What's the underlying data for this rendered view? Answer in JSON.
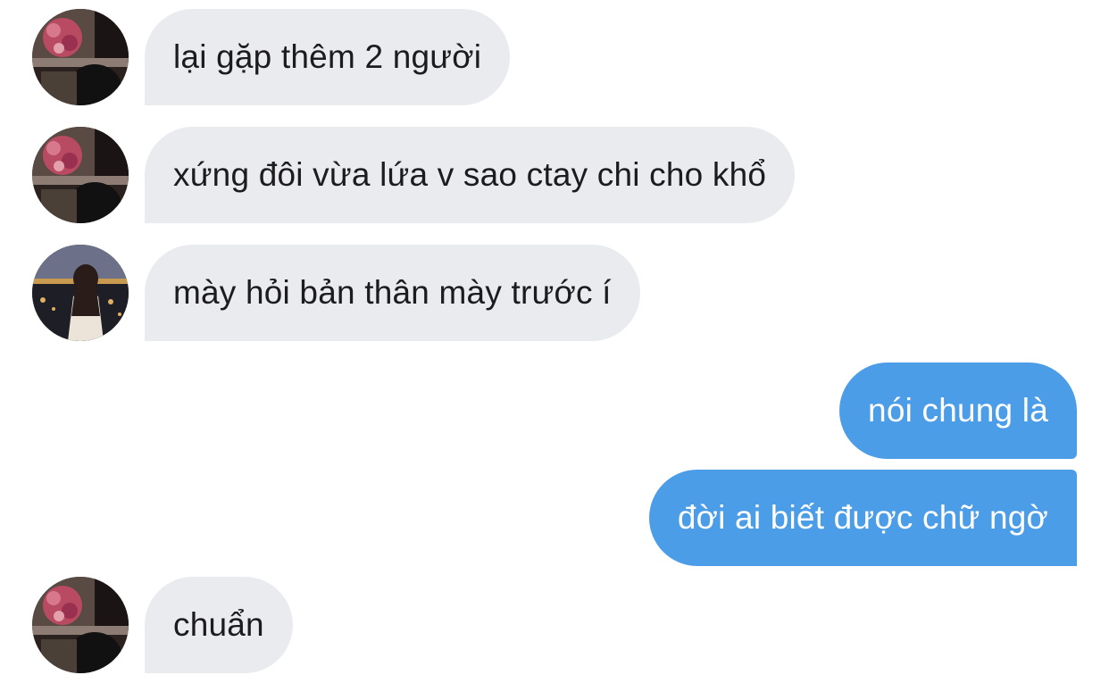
{
  "messages": [
    {
      "direction": "incoming",
      "text": "lại gặp thêm 2 người",
      "avatar": "avatar-flowers-girl"
    },
    {
      "direction": "incoming",
      "text": "xứng đôi vừa lứa v sao ctay chi cho khổ",
      "avatar": "avatar-flowers-girl"
    },
    {
      "direction": "incoming",
      "text": "mày hỏi bản thân mày trước í",
      "avatar": "avatar-girl-night-river"
    },
    {
      "direction": "outgoing",
      "text": "nói chung là"
    },
    {
      "direction": "outgoing",
      "text": "đời ai biết được chữ ngờ"
    },
    {
      "direction": "incoming",
      "text": "chuẩn",
      "avatar": "avatar-flowers-girl"
    }
  ],
  "colors": {
    "incoming_bubble": "#e9ebef",
    "outgoing_bubble": "#4c9de8",
    "incoming_text": "#1c1c1e",
    "outgoing_text": "#ffffff"
  }
}
